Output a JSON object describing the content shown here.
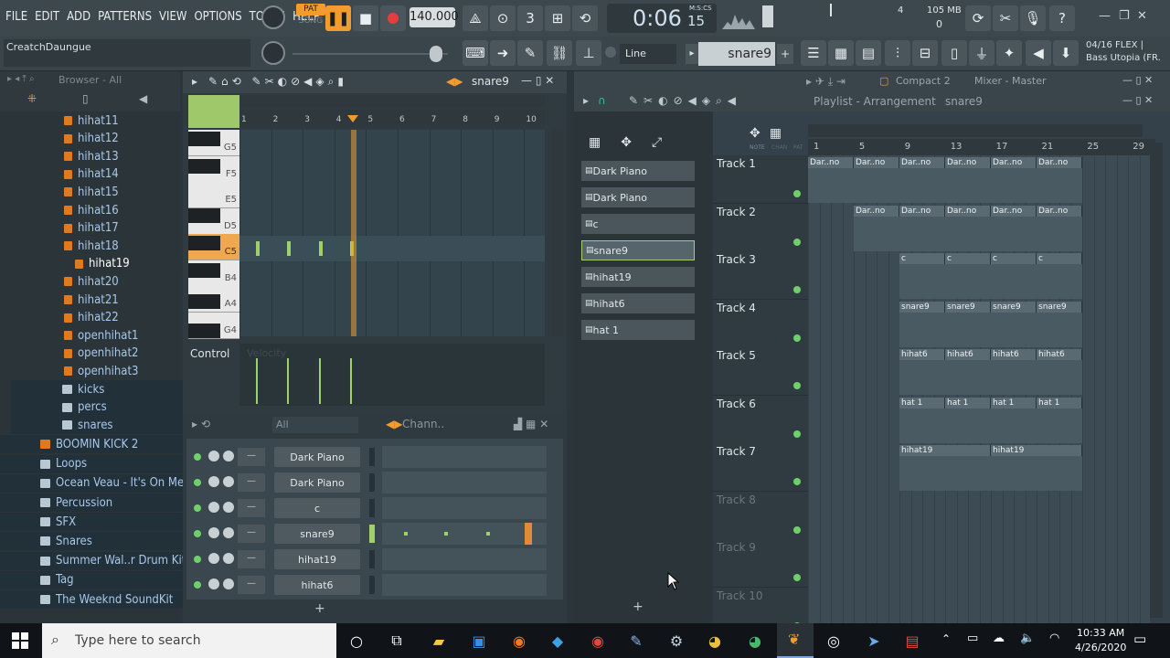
{
  "menu": [
    "FILE",
    "EDIT",
    "ADD",
    "PATTERNS",
    "VIEW",
    "OPTIONS",
    "TOOLS",
    "HELP"
  ],
  "transport": {
    "pat": "PAT",
    "song": "SONG",
    "tempo": "140.000",
    "time": "0:06",
    "time_small": "15",
    "time_label": "M:S:CS"
  },
  "hint": "CreatchDaungue",
  "stats": {
    "cpu": "4",
    "mem": "105 MB",
    "voices": "0"
  },
  "snap_mode": "Line",
  "current_pattern": "snare9",
  "flex": {
    "line1": "04/16 FLEX |",
    "line2": "Bass Utopia (FR."
  },
  "browser": {
    "header": "Browser - All",
    "items": [
      {
        "label": "hihat11",
        "type": "file"
      },
      {
        "label": "hihat12",
        "type": "file"
      },
      {
        "label": "hihat13",
        "type": "file"
      },
      {
        "label": "hihat14",
        "type": "file"
      },
      {
        "label": "hihat15",
        "type": "file"
      },
      {
        "label": "hihat16",
        "type": "file"
      },
      {
        "label": "hihat17",
        "type": "file"
      },
      {
        "label": "hihat18",
        "type": "file"
      },
      {
        "label": "hihat19",
        "type": "file-selected"
      },
      {
        "label": "hihat20",
        "type": "file"
      },
      {
        "label": "hihat21",
        "type": "file"
      },
      {
        "label": "hihat22",
        "type": "file"
      },
      {
        "label": "openhihat1",
        "type": "file"
      },
      {
        "label": "openhihat2",
        "type": "file"
      },
      {
        "label": "openhihat3",
        "type": "file"
      },
      {
        "label": "kicks",
        "type": "folder"
      },
      {
        "label": "percs",
        "type": "folder"
      },
      {
        "label": "snares",
        "type": "folder"
      },
      {
        "label": "BOOMIN KICK 2",
        "type": "pack"
      },
      {
        "label": "Loops",
        "type": "pack"
      },
      {
        "label": "Ocean Veau - It's On Me",
        "type": "pack"
      },
      {
        "label": "Percussion",
        "type": "pack"
      },
      {
        "label": "SFX",
        "type": "pack"
      },
      {
        "label": "Snares",
        "type": "pack"
      },
      {
        "label": "Summer Wal..r Drum Kit",
        "type": "pack"
      },
      {
        "label": "Tag",
        "type": "pack"
      },
      {
        "label": "The Weeknd SoundKit",
        "type": "pack"
      }
    ]
  },
  "pianoroll": {
    "title": "snare9",
    "bars": [
      "1",
      "2",
      "3",
      "4",
      "5",
      "6",
      "7",
      "8",
      "9",
      "10"
    ],
    "keys": [
      "G5",
      "F5",
      "E5",
      "D5",
      "C5",
      "B4",
      "A4",
      "G4"
    ],
    "control_label": "Control",
    "velocity_label": "Velocity"
  },
  "channel_rack": {
    "filter": "All",
    "title": "Chann..",
    "channels": [
      "Dark Piano",
      "Dark Piano",
      "c",
      "snare9",
      "hihat19",
      "hihat6"
    ]
  },
  "picker": {
    "items": [
      "Dark Piano",
      "Dark Piano",
      "c",
      "snare9",
      "hihat19",
      "hihat6",
      "hat 1"
    ]
  },
  "top_tabs": {
    "compact": "Compact 2",
    "mixer": "Mixer - Master"
  },
  "playlist": {
    "title": "Playlist - Arrangement",
    "pattern": "snare9",
    "note_label": "NOTE",
    "chan_label": "CHAN",
    "pat_label": "PAT",
    "bars": [
      "1",
      "5",
      "9",
      "13",
      "17",
      "21",
      "25",
      "29"
    ],
    "tracks": [
      "Track 1",
      "Track 2",
      "Track 3",
      "Track 4",
      "Track 5",
      "Track 6",
      "Track 7",
      "Track 8",
      "Track 9",
      "Track 10"
    ],
    "clip_labels": {
      "t1": "Dar..no",
      "t2": "Dar..no",
      "t3": "c",
      "t4": "snare9",
      "t5": "hihat6",
      "t6": "hat 1",
      "t7": "hihat19"
    }
  },
  "taskbar": {
    "search_placeholder": "Type here to search",
    "time": "10:33 AM",
    "date": "4/26/2020"
  }
}
